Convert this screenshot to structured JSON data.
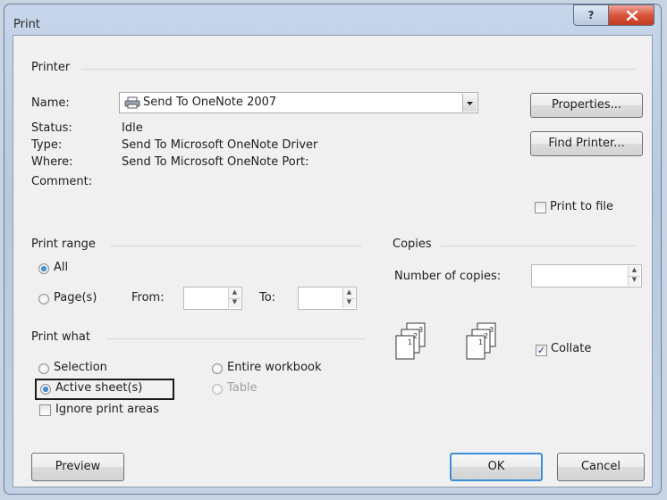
{
  "window": {
    "title": "Print",
    "help_label": "?"
  },
  "printer": {
    "group_label": "Printer",
    "name_label": "Name:",
    "name_value": "Send To OneNote 2007",
    "status_label": "Status:",
    "status_value": "Idle",
    "type_label": "Type:",
    "type_value": "Send To Microsoft OneNote Driver",
    "where_label": "Where:",
    "where_value": "Send To Microsoft OneNote Port:",
    "comment_label": "Comment:",
    "comment_value": "",
    "properties_button": "Properties...",
    "find_printer_button": "Find Printer...",
    "print_to_file_label": "Print to file",
    "print_to_file_checked": false
  },
  "print_range": {
    "group_label": "Print range",
    "all_label": "All",
    "pages_label": "Page(s)",
    "from_label": "From:",
    "to_label": "To:",
    "from_value": "",
    "to_value": "",
    "selected": "All"
  },
  "copies": {
    "group_label": "Copies",
    "number_label": "Number of copies:",
    "number_value": "",
    "collate_label": "Collate",
    "collate_checked": true
  },
  "print_what": {
    "group_label": "Print what",
    "selection_label": "Selection",
    "entire_workbook_label": "Entire workbook",
    "active_sheets_label": "Active sheet(s)",
    "table_label": "Table",
    "ignore_print_areas_label": "Ignore print areas",
    "selected": "Active sheet(s)"
  },
  "footer": {
    "preview_button": "Preview",
    "ok_button": "OK",
    "cancel_button": "Cancel"
  },
  "icons": [
    "help-icon",
    "close-icon",
    "printer-icon",
    "combo-chevron-down-icon",
    "collate-pages-icon"
  ],
  "colors": {
    "close_button": "#d8553c",
    "focus_border": "#1a1a1a",
    "default_button_border": "#3c8fd6"
  }
}
